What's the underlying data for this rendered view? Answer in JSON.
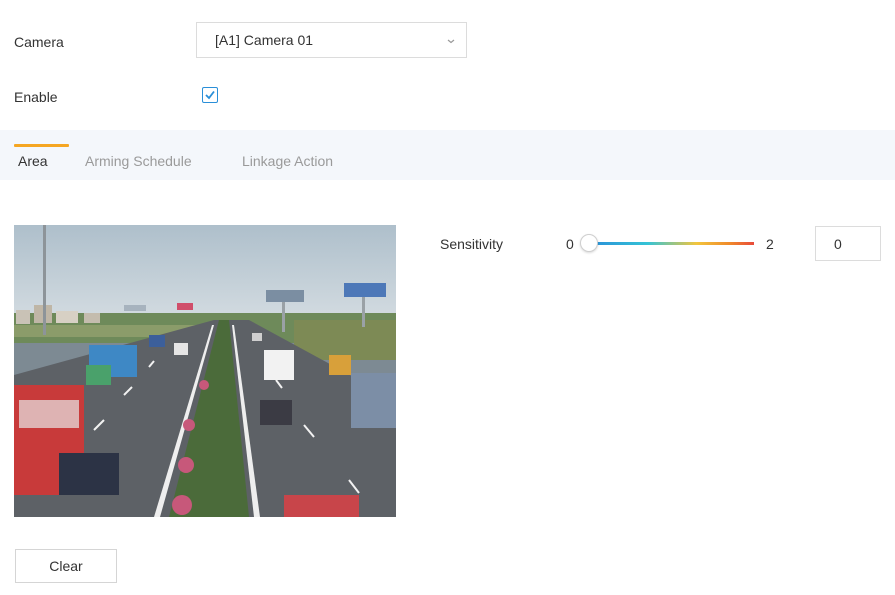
{
  "camera": {
    "label": "Camera",
    "selected": "[A1] Camera 01"
  },
  "enable": {
    "label": "Enable",
    "checked": true
  },
  "tabs": [
    {
      "label": "Area",
      "active": true
    },
    {
      "label": "Arming Schedule",
      "active": false
    },
    {
      "label": "Linkage Action",
      "active": false
    }
  ],
  "sensitivity": {
    "label": "Sensitivity",
    "min_label": "0",
    "max_label": "2",
    "value": "0"
  },
  "clear_label": "Clear",
  "colors": {
    "accent": "#2a8fd8",
    "tab_indicator": "#f5a623"
  },
  "icons": {
    "dropdown": "chevron-down-icon",
    "checkbox": "checkmark-icon"
  }
}
